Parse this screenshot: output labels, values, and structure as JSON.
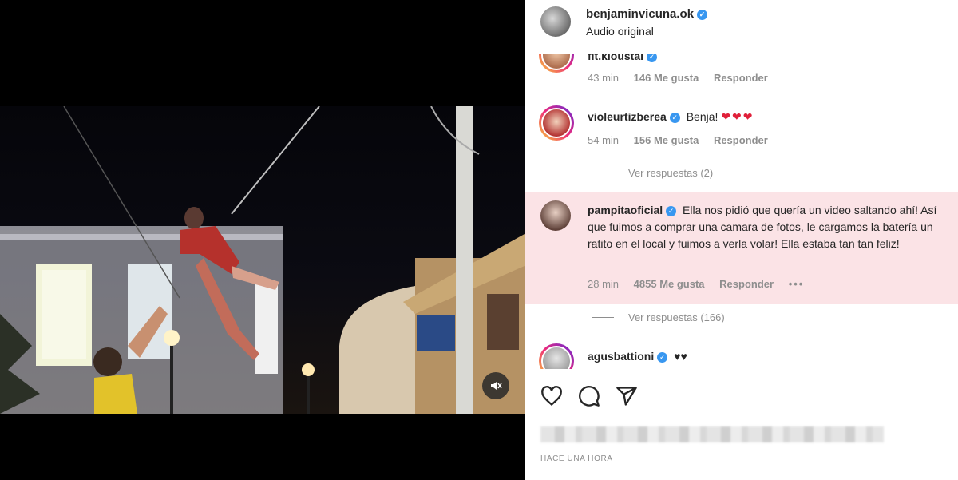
{
  "header": {
    "username": "benjaminvicuna.ok",
    "audio": "Audio original"
  },
  "comments": [
    {
      "username": "fit.kioustal",
      "text": "",
      "time": "43 min",
      "likes": "146 Me gusta",
      "reply": "Responder"
    },
    {
      "username": "violeurtizberea",
      "text": "Benja!",
      "hearts": "❤❤❤",
      "time": "54 min",
      "likes": "156 Me gusta",
      "reply": "Responder",
      "view_replies": "Ver respuestas (2)"
    },
    {
      "username": "pampitaoficial",
      "text": "Ella nos pidió que quería un video saltando ahí! Así que fuimos a comprar una camara de fotos, le cargamos la batería un ratito en el local y fuimos a verla volar! Ella estaba tan tan feliz!",
      "time": "28 min",
      "likes": "4855 Me gusta",
      "reply": "Responder",
      "more": "•••",
      "view_replies": "Ver respuestas (166)",
      "highlight_color": "#fbe3e6"
    },
    {
      "username": "agusbattioni",
      "text": "♥♥"
    }
  ],
  "footer": {
    "time_ago": "HACE UNA HORA"
  },
  "icons": {
    "like": "heart-icon",
    "comment": "comment-icon",
    "share": "send-icon",
    "mute": "muted-speaker-icon"
  }
}
